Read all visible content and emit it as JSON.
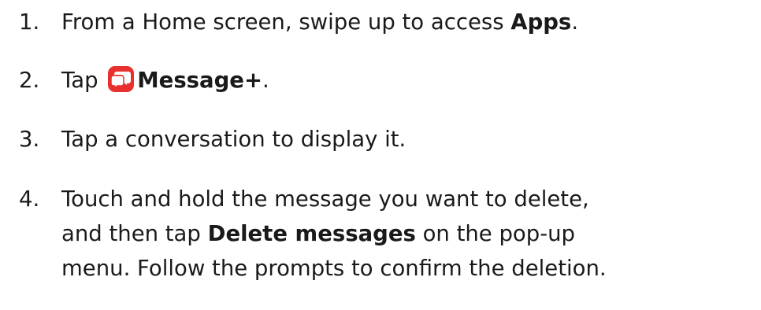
{
  "steps": [
    {
      "number": "1.",
      "parts": [
        "From a Home screen, swipe up to access ",
        "Apps",
        "."
      ]
    },
    {
      "number": "2.",
      "parts": [
        "Tap ",
        "Message+",
        "."
      ],
      "icon": "message-plus-app-icon",
      "icon_color": "#e8302e"
    },
    {
      "number": "3.",
      "parts": [
        "Tap a conversation to display it."
      ]
    },
    {
      "number": "4.",
      "lines": [
        [
          "Touch and hold the message you want to delete,"
        ],
        [
          "and then tap ",
          "Delete messages",
          " on the pop-up"
        ],
        [
          "menu. Follow the prompts to confirm the deletion."
        ]
      ]
    }
  ]
}
